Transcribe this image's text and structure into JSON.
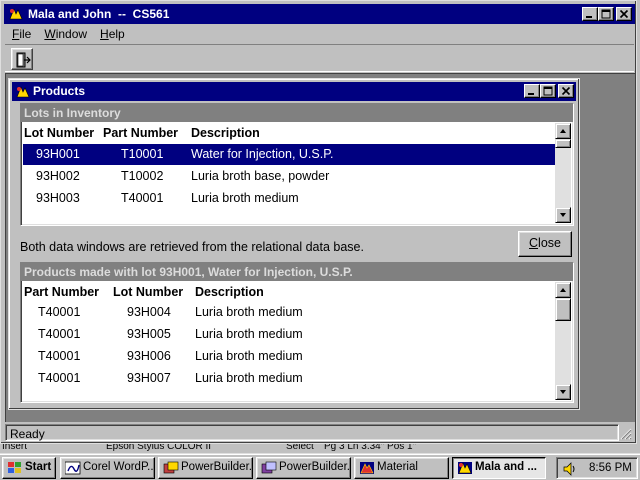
{
  "main_window": {
    "title": "Mala and John  --  CS561",
    "menus": [
      {
        "label": "File",
        "accel": "F",
        "rest": "ile"
      },
      {
        "label": "Window",
        "accel": "W",
        "rest": "indow"
      },
      {
        "label": "Help",
        "accel": "H",
        "rest": "elp"
      }
    ],
    "toolbar": {
      "exit_icon": "exit-door-icon"
    },
    "status": "Ready"
  },
  "products_window": {
    "title": "Products",
    "lots": {
      "header": "Lots in Inventory",
      "columns": [
        "Lot Number",
        "Part Number",
        "Description"
      ],
      "rows": [
        {
          "lot": "93H001",
          "part": "T10001",
          "desc": "Water for Injection, U.S.P.",
          "selected": true
        },
        {
          "lot": "93H002",
          "part": "T10002",
          "desc": "Luria broth base, powder",
          "selected": false
        },
        {
          "lot": "93H003",
          "part": "T40001",
          "desc": "Luria broth medium",
          "selected": false
        }
      ]
    },
    "info_text": "Both data windows are retrieved from the relational data base.",
    "close_button": {
      "accel": "C",
      "rest": "lose"
    },
    "made_with": {
      "header": "Products made with lot 93H001, Water for Injection, U.S.P.",
      "columns": [
        "Part Number",
        "Lot Number",
        "Description"
      ],
      "rows": [
        {
          "part": "T40001",
          "lot": "93H004",
          "desc": "Luria broth medium"
        },
        {
          "part": "T40001",
          "lot": "93H005",
          "desc": "Luria broth medium"
        },
        {
          "part": "T40001",
          "lot": "93H006",
          "desc": "Luria broth medium"
        },
        {
          "part": "T40001",
          "lot": "93H007",
          "desc": "Luria broth medium"
        }
      ]
    }
  },
  "behind_strip": [
    "Insert",
    "Epson Stylus COLOR II",
    "Select",
    "Pg 3 Ln 3.34\" Pos 1\""
  ],
  "taskbar": {
    "start": "Start",
    "buttons": [
      {
        "label": "Corel WordP...",
        "icon": "wordperfect-icon",
        "active": false
      },
      {
        "label": "PowerBuilder...",
        "icon": "powerbuilder-icon",
        "active": false
      },
      {
        "label": "PowerBuilder...",
        "icon": "powerbuilder-icon",
        "active": false
      },
      {
        "label": "Material",
        "icon": "material-app-icon",
        "active": false
      },
      {
        "label": "Mala and ...",
        "icon": "app-icon",
        "active": true
      }
    ],
    "clock": "8:56 PM"
  },
  "colors": {
    "title_active": "#000080",
    "face": "#c0c0c0",
    "desktop": "#808080",
    "selection": "#000080"
  }
}
